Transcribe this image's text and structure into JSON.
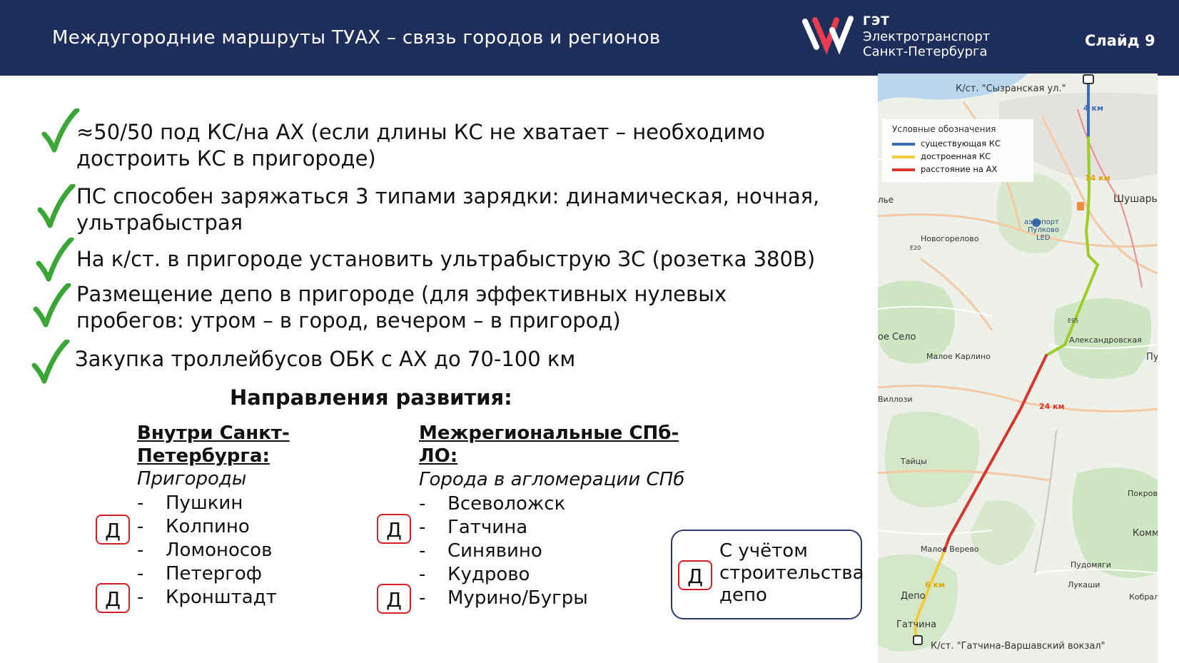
{
  "header": {
    "title": "Междугородние маршруты ТУАХ – связь городов и регионов",
    "logo_abbr": "ГЭТ",
    "logo_line1": "Электротранспорт",
    "logo_line2": "Санкт-Петербурга",
    "slide_number": "Слайд 9"
  },
  "bullets": [
    {
      "line1": "≈50/50 под КС/на АХ (если длины КС не хватает – необходимо",
      "line2": "достроить  КС в пригороде)"
    },
    {
      "line1": "ПС способен заряжаться 3 типами зарядки: динамическая, ночная,",
      "line2": "ультрабыстрая"
    },
    {
      "line1": "На к/ст. в пригороде установить ультрабыструю ЗС (розетка 380В)",
      "line2": ""
    },
    {
      "line1": "Размещение депо в пригороде (для эффективных нулевых",
      "line2": "пробегов: утром – в город, вечером – в пригород)"
    },
    {
      "line1": "Закупка троллейбусов ОБК с АХ до 70-100 км",
      "line2": ""
    }
  ],
  "directions": {
    "title": "Направления развития:",
    "left": {
      "heading_line1": "Внутри Санкт-",
      "heading_line2": "Петербурга:",
      "subtitle": "Пригороды",
      "items": [
        "Пушкин",
        "Колпино",
        "Ломоносов",
        "Петергоф",
        "Кронштадт"
      ]
    },
    "right": {
      "heading_line1": "Межрегиональные СПб-",
      "heading_line2": "ЛО:",
      "subtitle": "Города в агломерации СПб",
      "items": [
        "Всеволожск",
        "Гатчина",
        "Синявино",
        "Кудрово",
        "Мурино/Бугры"
      ]
    },
    "dash": "-",
    "badge": "Д",
    "note": {
      "line1": "С учётом",
      "line2": "строительства",
      "line3": "депо"
    }
  },
  "map": {
    "legend": {
      "title": "Условные обозначения",
      "items": [
        {
          "label": "существующая КС",
          "color": "#3a6fb5"
        },
        {
          "label": "достроенная КС",
          "color": "#f2cc3a"
        },
        {
          "label": "расстояние на АХ",
          "color": "#d6382f"
        }
      ]
    },
    "stop_top": "К/ст. \"Сызранская ул.\"",
    "stop_bottom": "К/ст. \"Гатчина-Варшавский вокзал\"",
    "distances": {
      "d1": "4 км",
      "d2": "14 км",
      "d3": "24 км",
      "d4": "6 км"
    },
    "places": {
      "shushary": "Шушары",
      "airport1": "аэропорт",
      "airport2": "Пулково",
      "airport3": "LED",
      "novogorelovo": "Новогорелово",
      "alexandrovskaya": "Александровская",
      "maloe_karlino": "Малое Карлино",
      "tsarskoe": "ое Село",
      "villozi": "Виллози",
      "taitsy": "Тайцы",
      "pokrov": "Покров",
      "kommunar": "Коммун",
      "maloe_verevo": "Малое Верево",
      "pudomyagi": "Пудомяги",
      "lukashi": "Лукаши",
      "kobralovo": "Кобрало",
      "depo": "Депо",
      "gatchina": "Гатчина",
      "pu": "Пу",
      "ile": "лье",
      "e20": "E20",
      "e95": "E95"
    },
    "colors": {
      "existing": "#3a6fb5",
      "built": "#9ccc2a",
      "battery": "#d6382f",
      "yellow": "#f2cc3a"
    }
  }
}
